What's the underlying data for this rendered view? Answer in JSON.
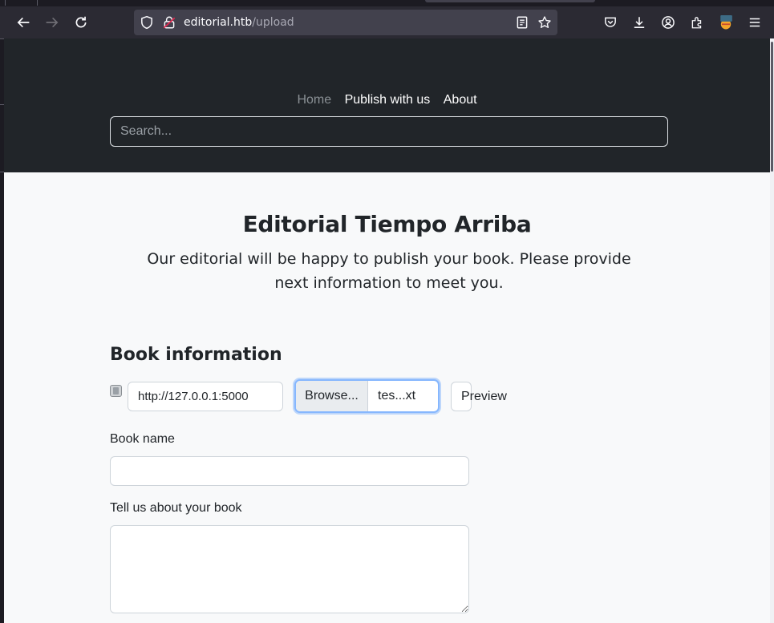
{
  "browser": {
    "url_host": "editorial.htb",
    "url_path": "/upload"
  },
  "nav": {
    "home": "Home",
    "publish": "Publish with us",
    "about": "About"
  },
  "search": {
    "placeholder": "Search..."
  },
  "main": {
    "title": "Editorial Tiempo Arriba",
    "subtitle": "Our editorial will be happy to publish your book. Please provide next information to meet you."
  },
  "form": {
    "section_title": "Book information",
    "cover_url_value": "http://127.0.0.1:5000",
    "browse_label": "Browse...",
    "file_name": "tes...xt",
    "preview_label": "Preview",
    "book_name_label": "Book name",
    "about_label": "Tell us about your book"
  },
  "colors": {
    "hero_bg": "#212529",
    "page_bg": "#f8f9fa",
    "focus_ring": "#86b7fe"
  }
}
